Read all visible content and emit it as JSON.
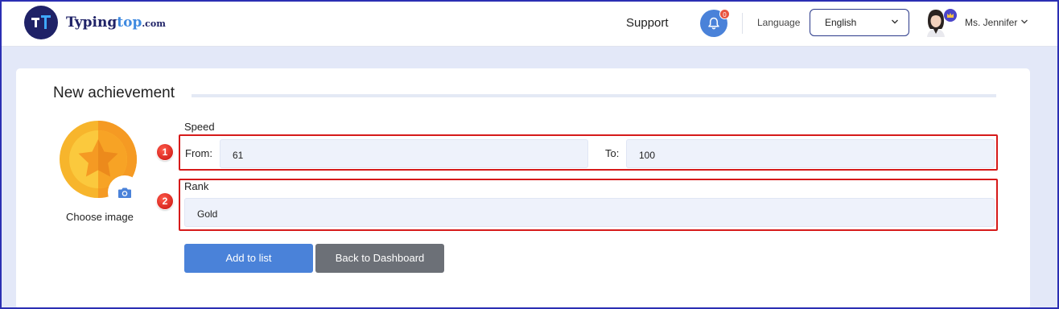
{
  "header": {
    "logo": {
      "name_part1": "Typing",
      "name_part2": "top",
      "name_part3": ".com"
    },
    "support_label": "Support",
    "notifications_count": "0",
    "language_label": "Language",
    "language_value": "English",
    "user_name": "Ms. Jennifer"
  },
  "card": {
    "title": "New achievement",
    "choose_image_label": "Choose image",
    "speed_label": "Speed",
    "from_label": "From:",
    "from_value": "61",
    "to_label": "To:",
    "to_value": "100",
    "rank_label": "Rank",
    "rank_value": "Gold",
    "markers": [
      "1",
      "2"
    ],
    "buttons": {
      "add": "Add to list",
      "back": "Back to Dashboard"
    }
  },
  "colors": {
    "primary": "#4a82d9",
    "secondary_button": "#6c7077",
    "highlight_box": "#d61a1a",
    "page_bg": "#e3e8f8",
    "medal_gold": "#f7b52c"
  },
  "icons": [
    "logo-icon",
    "bell-icon",
    "chevron-down-icon",
    "crown-icon",
    "medal-star-icon",
    "camera-icon"
  ]
}
